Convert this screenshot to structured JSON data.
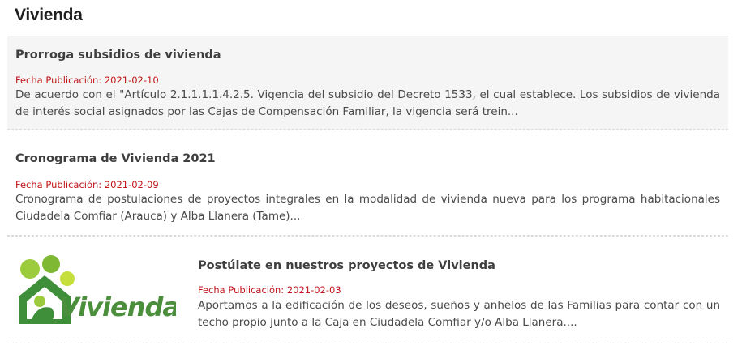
{
  "section": {
    "title": "Vivienda"
  },
  "news": [
    {
      "title": "Prorroga subsidios de vivienda",
      "date_label": "Fecha Publicación: 2021-02-10",
      "summary": "De acuerdo con el \"Artículo 2.1.1.1.1.4.2.5. Vigencia del subsidio del Decreto 1533, el cual establece. Los subsidios de vivienda de interés social asignados por las Cajas de Compensación Familiar, la vigencia será trein..."
    },
    {
      "title": "Cronograma de Vivienda 2021",
      "date_label": "Fecha Publicación: 2021-02-09",
      "summary": "Cronograma de postulaciones de proyectos integrales en la modalidad de vivienda nueva para los programa habitacionales Ciudadela Comfiar (Arauca) y Alba Llanera (Tame)..."
    },
    {
      "title": "Postúlate en nuestros proyectos de Vivienda",
      "date_label": "Fecha Publicación: 2021-02-03",
      "summary": "Aportamos a la edificación de los deseos, sueños y anhelos de las Familias para contar con un techo propio junto a la Caja en Ciudadela Comfiar y/o Alba Llanera....",
      "logo_text": "Vivienda"
    }
  ],
  "colors": {
    "date": "#c0161b",
    "logo_green_light": "#9ccb3b",
    "logo_green_dark": "#3a8a3a"
  }
}
